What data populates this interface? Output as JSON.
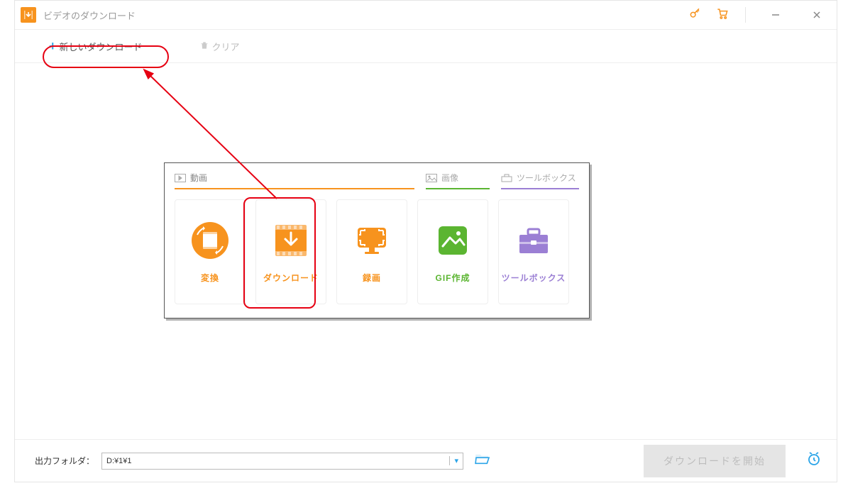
{
  "titlebar": {
    "title": "ビデオのダウンロード"
  },
  "toolbar": {
    "new_download": "新しいダウンロード",
    "clear": "クリア"
  },
  "panel": {
    "tabs": {
      "video": "動画",
      "image": "画像",
      "toolbox": "ツールボックス"
    },
    "cards": {
      "convert": "変換",
      "download": "ダウンロード",
      "record": "録画",
      "gif": "GIF作成",
      "toolbox": "ツールボックス"
    }
  },
  "footer": {
    "output_label": "出力フォルダ：",
    "output_path": "D:¥1¥1",
    "start_button": "ダウンロードを開始"
  }
}
